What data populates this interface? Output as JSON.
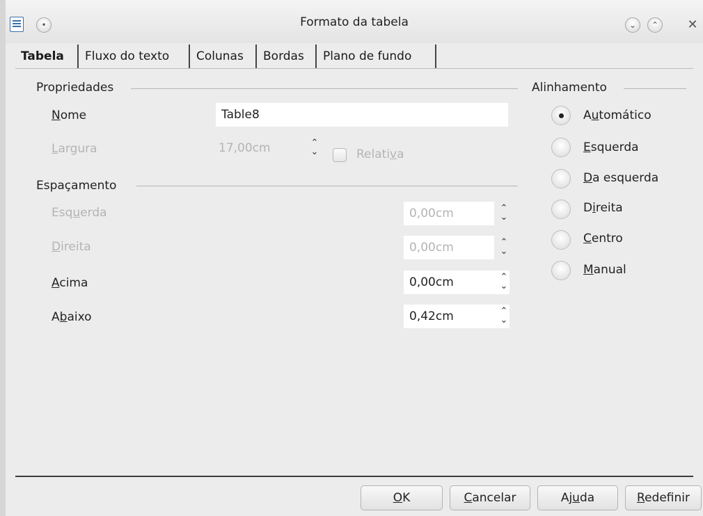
{
  "window": {
    "title": "Formato da tabela"
  },
  "tabs": [
    {
      "label": "Tabela",
      "active": true
    },
    {
      "label": "Fluxo do texto",
      "active": false
    },
    {
      "label": "Colunas",
      "active": false
    },
    {
      "label": "Bordas",
      "active": false
    },
    {
      "label": "Plano de fundo",
      "active": false
    }
  ],
  "propriedades": {
    "legend": "Propriedades",
    "nome_label": {
      "u": "N",
      "rest": "ome"
    },
    "nome_value": "Table8",
    "largura_label": {
      "u": "L",
      "rest": "argura"
    },
    "largura_value": "17,00cm",
    "relativa_label": {
      "pre": "Relati",
      "u": "v",
      "post": "a"
    },
    "relativa_checked": false,
    "largura_enabled": false
  },
  "espacamento": {
    "legend": "Espaçamento",
    "rows": [
      {
        "pre": "Esq",
        "u": "u",
        "post": "erda",
        "value": "0,00cm",
        "enabled": false
      },
      {
        "pre": "",
        "u": "D",
        "post": "ireita",
        "value": "0,00cm",
        "enabled": false
      },
      {
        "pre": "",
        "u": "A",
        "post": "cima",
        "value": "0,00cm",
        "enabled": true
      },
      {
        "pre": "A",
        "u": "b",
        "post": "aixo",
        "value": "0,42cm",
        "enabled": true
      }
    ]
  },
  "alinhamento": {
    "legend": "Alinhamento",
    "options": [
      {
        "pre": "A",
        "u": "u",
        "post": "tomático",
        "selected": true
      },
      {
        "pre": "",
        "u": "E",
        "post": "squerda",
        "selected": false
      },
      {
        "pre": "",
        "u": "D",
        "post": "a esquerda",
        "selected": false
      },
      {
        "pre": "D",
        "u": "i",
        "post": "reita",
        "selected": false
      },
      {
        "pre": "",
        "u": "C",
        "post": "entro",
        "selected": false
      },
      {
        "pre": "",
        "u": "M",
        "post": "anual",
        "selected": false
      }
    ]
  },
  "buttons": {
    "ok": {
      "pre": "",
      "u": "O",
      "post": "K"
    },
    "cancelar": {
      "pre": "",
      "u": "C",
      "post": "ancelar"
    },
    "ajuda": {
      "pre": "Aj",
      "u": "u",
      "post": "da"
    },
    "redefinir": {
      "pre": "",
      "u": "R",
      "post": "edefinir"
    }
  },
  "icons": {
    "app": "document-icon",
    "menu": "window-menu-icon",
    "minimize": "chevron-down-icon",
    "maximize": "chevron-up-icon",
    "close": "close-icon"
  }
}
